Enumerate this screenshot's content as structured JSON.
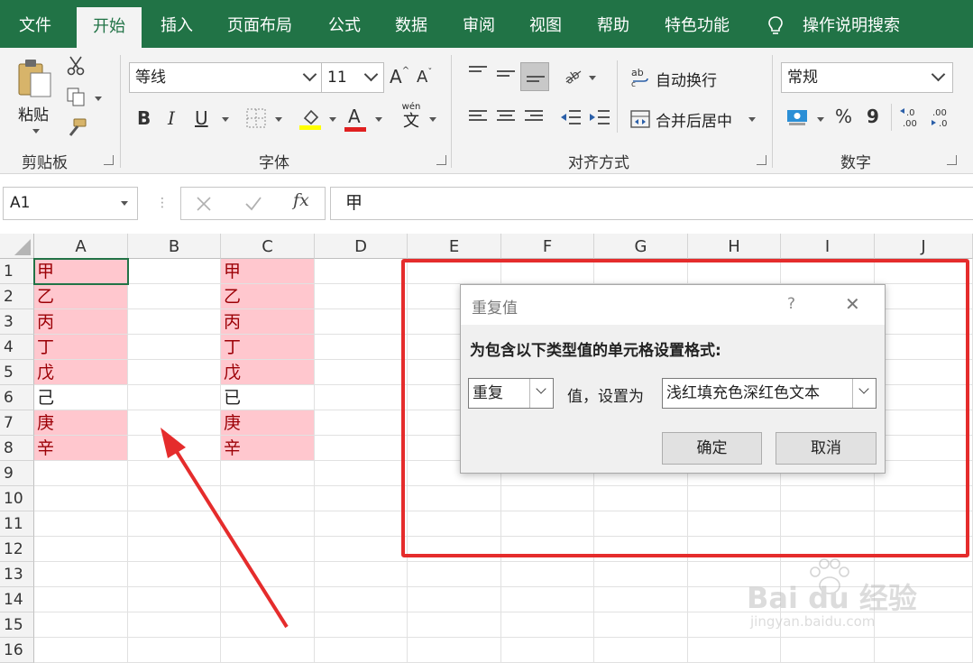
{
  "tabs": [
    "文件",
    "开始",
    "插入",
    "页面布局",
    "公式",
    "数据",
    "审阅",
    "视图",
    "帮助",
    "特色功能"
  ],
  "search": "操作说明搜索",
  "clipboard": {
    "paste": "粘贴",
    "group": "剪贴板"
  },
  "font": {
    "name": "等线",
    "size": "11",
    "bold": "B",
    "italic": "I",
    "underline": "U",
    "phonetic_top": "wén",
    "phonetic_bottom": "文",
    "group": "字体"
  },
  "alignment": {
    "wrap": "自动换行",
    "merge": "合并后居中",
    "group": "对齐方式"
  },
  "number": {
    "format": "常规",
    "percent": "%",
    "comma": "9",
    "group": "数字"
  },
  "formula_bar": {
    "name_box": "A1",
    "fx": "fx",
    "content": "甲"
  },
  "grid": {
    "columns": [
      "A",
      "B",
      "C",
      "D",
      "E",
      "F",
      "G",
      "H",
      "I",
      "J"
    ],
    "rows": [
      "1",
      "2",
      "3",
      "4",
      "5",
      "6",
      "7",
      "8",
      "9",
      "10",
      "11",
      "12",
      "13",
      "14",
      "15",
      "16"
    ],
    "colA": [
      "甲",
      "乙",
      "丙",
      "丁",
      "戊",
      "己",
      "庚",
      "辛"
    ],
    "colC": [
      "甲",
      "乙",
      "丙",
      "丁",
      "戊",
      "已",
      "庚",
      "辛"
    ]
  },
  "dialog": {
    "title": "重复值",
    "help": "?",
    "close": "✕",
    "prompt": "为包含以下类型值的单元格设置格式:",
    "type_value": "重复",
    "mid_label": "值，设置为",
    "format_value": "浅红填充色深红色文本",
    "ok": "确定",
    "cancel": "取消"
  },
  "watermark": {
    "brand": "Bai du 经验",
    "url": "jingyan.baidu.com"
  },
  "colors": {
    "excel_green": "#217346",
    "dup_fill": "#ffc7ce",
    "dup_text": "#9c0006",
    "annotation_red": "#e52c2c"
  }
}
